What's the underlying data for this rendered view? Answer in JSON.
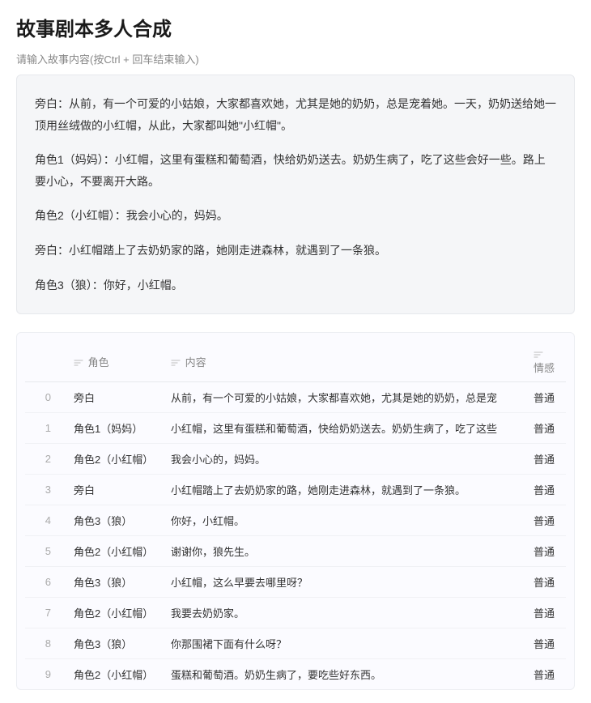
{
  "header": {
    "title": "故事剧本多人合成",
    "subtitle": "请输入故事内容(按Ctrl + 回车结束输入)"
  },
  "story": {
    "paragraphs": [
      "旁白：从前，有一个可爱的小姑娘，大家都喜欢她，尤其是她的奶奶，总是宠着她。一天，奶奶送给她一顶用丝绒做的小红帽，从此，大家都叫她\"小红帽\"。",
      "角色1（妈妈）：小红帽，这里有蛋糕和葡萄酒，快给奶奶送去。奶奶生病了，吃了这些会好一些。路上要小心，不要离开大路。",
      "角色2（小红帽）：我会小心的，妈妈。",
      "旁白：小红帽踏上了去奶奶家的路，她刚走进森林，就遇到了一条狼。",
      "角色3（狼）：你好，小红帽。"
    ]
  },
  "table": {
    "headers": {
      "role": "角色",
      "content": "内容",
      "emotion": "情感"
    },
    "rows": [
      {
        "idx": "0",
        "role": "旁白",
        "content": "从前，有一个可爱的小姑娘，大家都喜欢她，尤其是她的奶奶，总是宠",
        "emotion": "普通"
      },
      {
        "idx": "1",
        "role": "角色1（妈妈）",
        "content": "小红帽，这里有蛋糕和葡萄酒，快给奶奶送去。奶奶生病了，吃了这些",
        "emotion": "普通"
      },
      {
        "idx": "2",
        "role": "角色2（小红帽）",
        "content": "我会小心的，妈妈。",
        "emotion": "普通"
      },
      {
        "idx": "3",
        "role": "旁白",
        "content": "小红帽踏上了去奶奶家的路，她刚走进森林，就遇到了一条狼。",
        "emotion": "普通"
      },
      {
        "idx": "4",
        "role": "角色3（狼）",
        "content": "你好，小红帽。",
        "emotion": "普通"
      },
      {
        "idx": "5",
        "role": "角色2（小红帽）",
        "content": "谢谢你，狼先生。",
        "emotion": "普通"
      },
      {
        "idx": "6",
        "role": "角色3（狼）",
        "content": "小红帽，这么早要去哪里呀？",
        "emotion": "普通"
      },
      {
        "idx": "7",
        "role": "角色2（小红帽）",
        "content": "我要去奶奶家。",
        "emotion": "普通"
      },
      {
        "idx": "8",
        "role": "角色3（狼）",
        "content": "你那围裙下面有什么呀？",
        "emotion": "普通"
      },
      {
        "idx": "9",
        "role": "角色2（小红帽）",
        "content": "蛋糕和葡萄酒。奶奶生病了，要吃些好东西。",
        "emotion": "普通"
      }
    ]
  }
}
